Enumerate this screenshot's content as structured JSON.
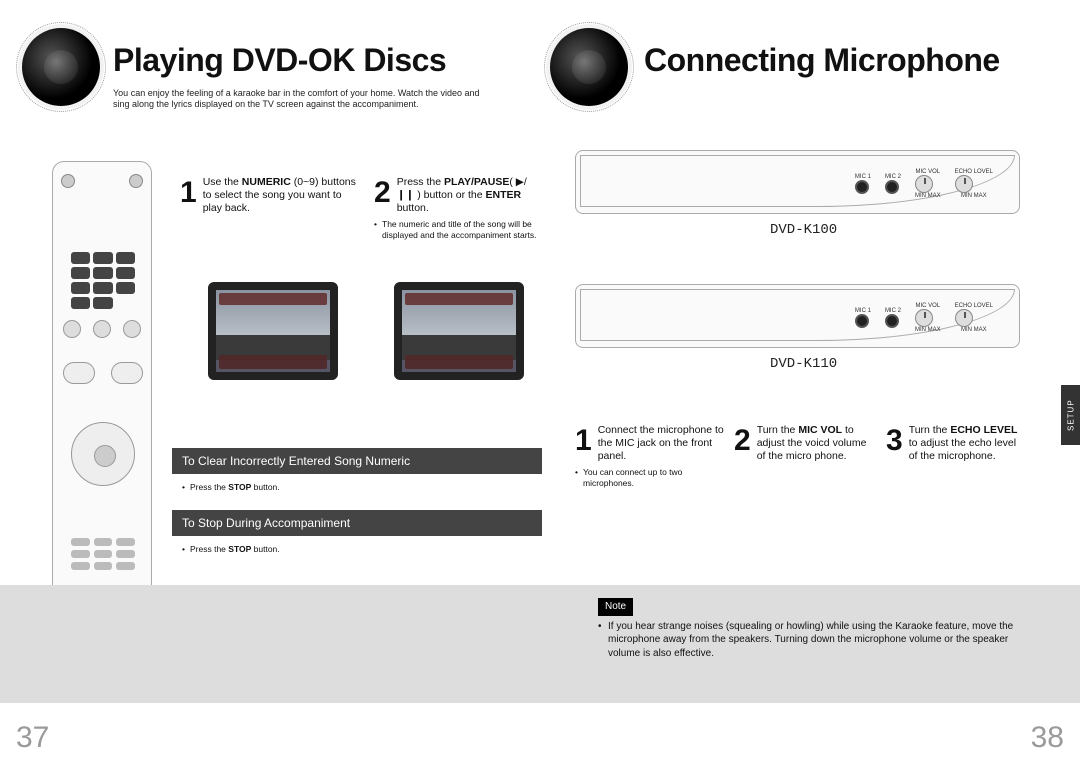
{
  "left": {
    "title": "Playing DVD-OK Discs",
    "intro": "You can enjoy the feeling of a karaoke bar in the comfort of your home. Watch the video and sing along the lyrics displayed on the TV screen against the accompaniment.",
    "step1_pre": "Use the ",
    "step1_bold": "NUMERIC",
    "step1_post": " (0~9) buttons to select the song you want to play back.",
    "step2_pre": "Press the ",
    "step2_bold1": "PLAY/PAUSE",
    "step2_sym": "( ▶/❙❙ )",
    "step2_mid": " button or the ",
    "step2_bold2": "ENTER",
    "step2_post": " button.",
    "step2_note": "The numeric and title of the song will be displayed and the accompaniment starts.",
    "sub1": "To Clear Incorrectly Entered Song Numeric",
    "sub1_note_pre": "Press the ",
    "sub1_note_bold": "STOP",
    "sub1_note_post": " button.",
    "sub2": "To Stop During Accompaniment",
    "sub2_note_pre": "Press the ",
    "sub2_note_bold": "STOP",
    "sub2_note_post": " button.",
    "page_num": "37"
  },
  "right": {
    "title": "Connecting Microphone",
    "model1": "DVD-K100",
    "model2": "DVD-K110",
    "panel_mic1": "MIC 1",
    "panel_mic2": "MIC 2",
    "panel_micvol": "MIC VOL",
    "panel_echo": "ECHO LOVEL",
    "panel_min": "MIN",
    "panel_max": "MAX",
    "step1": "Connect the microphone to the MIC jack on the front panel.",
    "step1_note": "You can connect up to two microphones.",
    "step2_pre": "Turn the ",
    "step2_bold": "MIC VOL",
    "step2_post": " to adjust the voicd volume of the micro phone.",
    "step3_pre": "Turn the ",
    "step3_bold1": "ECHO",
    "step3_mid": " ",
    "step3_bold2": "LEVEL",
    "step3_post": " to adjust the echo level of the microphone.",
    "note_label": "Note",
    "note_body": "If you hear strange noises (squealing or howling) while using the Karaoke feature, move the microphone away from the speakers. Turning down the microphone volume or the speaker volume is also effective.",
    "tab": "SETUP",
    "page_num": "38"
  }
}
